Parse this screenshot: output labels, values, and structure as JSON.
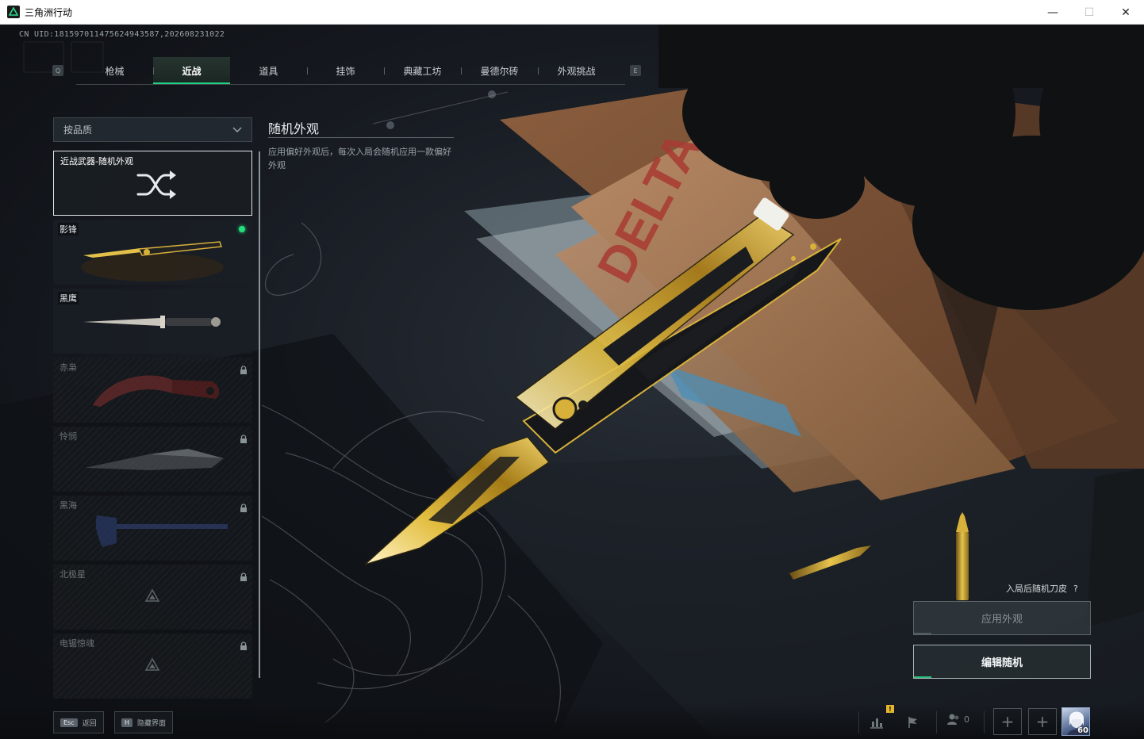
{
  "window": {
    "title": "三角洲行动",
    "controls": [
      "minimize-icon",
      "maximize-icon",
      "close-icon"
    ]
  },
  "uid": "CN UID:1815970114756249435​87,20260823102​2",
  "tabs": {
    "key_left": "Q",
    "key_right": "E",
    "items": [
      {
        "label": "枪械",
        "active": false
      },
      {
        "label": "近战",
        "active": true
      },
      {
        "label": "道具",
        "active": false
      },
      {
        "label": "挂饰",
        "active": false
      },
      {
        "label": "典藏工坊",
        "active": false
      },
      {
        "label": "曼德尔砖",
        "active": false
      },
      {
        "label": "外观挑战",
        "active": false
      }
    ]
  },
  "filter": {
    "label": "按品质",
    "icon": "chevron-down-icon"
  },
  "list": {
    "random_card": {
      "label": "近战武器-随机外观",
      "icon": "shuffle-icon"
    },
    "items": [
      {
        "label": "影锋",
        "locked": false,
        "equipped": true
      },
      {
        "label": "黑鹰",
        "locked": false,
        "equipped": false
      },
      {
        "label": "赤枭",
        "locked": true,
        "equipped": false
      },
      {
        "label": "怜悯",
        "locked": true,
        "equipped": false
      },
      {
        "label": "黑海",
        "locked": true,
        "equipped": false
      },
      {
        "label": "北极星",
        "locked": true,
        "equipped": false
      },
      {
        "label": "电锯惊魂",
        "locked": true,
        "equipped": false
      }
    ]
  },
  "info": {
    "title": "随机外观",
    "description": "应用偏好外观后，每次入局会随机应用一款偏好外观"
  },
  "actions": {
    "random_label": "入局后随机刀皮",
    "help": "?",
    "apply": "应用外观",
    "edit": "编辑随机"
  },
  "bottom": {
    "back_key": "Esc",
    "back_label": "返回",
    "hide_key": "H",
    "hide_label": "隐藏界面",
    "badge": "!",
    "friends_count": "0",
    "add": "+",
    "level": "60"
  },
  "colors": {
    "accent": "#1fcf83",
    "equipped_dot": "#23e07c",
    "gold": "#d8b13a"
  }
}
